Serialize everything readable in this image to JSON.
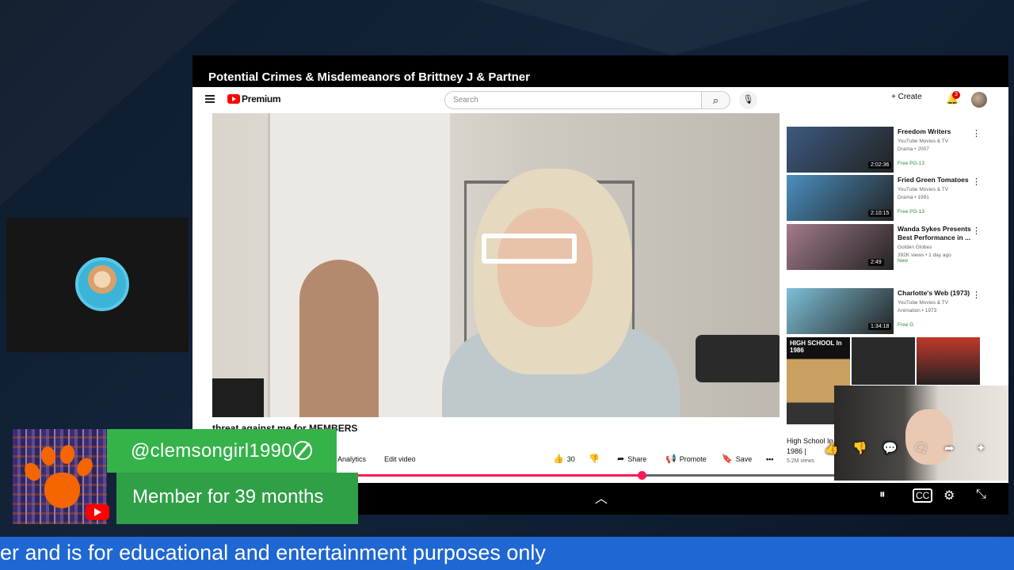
{
  "window": {
    "title": "Potential Crimes & Misdemeanors of Brittney J & Partner"
  },
  "youtube": {
    "logo_text": "Premium",
    "search_placeholder": "Search",
    "create_label": "+ Create",
    "notification_count": "3",
    "video_title_partial": "threat against me for MEMBERS",
    "actions": {
      "analytics": "Analytics",
      "edit_video": "Edit video",
      "likes": "30",
      "share": "Share",
      "promote": "Promote",
      "save": "Save"
    },
    "progress_fraction": 0.55,
    "recommendations": [
      {
        "title": "Freedom Writers",
        "meta1": "YouTube Movies & TV",
        "meta2": "Drama • 2007",
        "tags": "Free   PG-13",
        "duration": "2:02:36",
        "thumb_color": "#3d5a80"
      },
      {
        "title": "Fried Green Tomatoes",
        "meta1": "YouTube Movies & TV",
        "meta2": "Drama • 1991",
        "tags": "Free   PG-13",
        "duration": "2:10:15",
        "thumb_color": "#4b8fbf"
      },
      {
        "title": "Wanda Sykes Presents Best Performance in ...",
        "meta1": "Golden Globes",
        "meta2": "392K views • 1 day ago",
        "tags": "New",
        "duration": "2:49",
        "thumb_color": "#a37a8c"
      },
      {
        "title": "Charlotte's Web (1973)",
        "meta1": "YouTube Movies & TV",
        "meta2": "Animation • 1973",
        "tags": "Free   G",
        "duration": "1:34:18",
        "thumb_color": "#7ec0d8"
      }
    ],
    "highschool": {
      "title": "High School In 1986 |",
      "views": "5.2M views",
      "thumb_label": "HIGH SCHOOL In 1986"
    }
  },
  "member_alert": {
    "username": "@clemsongirl1990",
    "message": "Member for 39 months"
  },
  "ticker": {
    "text": "er and is for educational and entertainment purposes only"
  },
  "colors": {
    "alert_green": "#35b24a",
    "ticker_blue": "#1f67d2",
    "progress_red": "#ff1a55",
    "clemson_orange": "#f56600"
  }
}
